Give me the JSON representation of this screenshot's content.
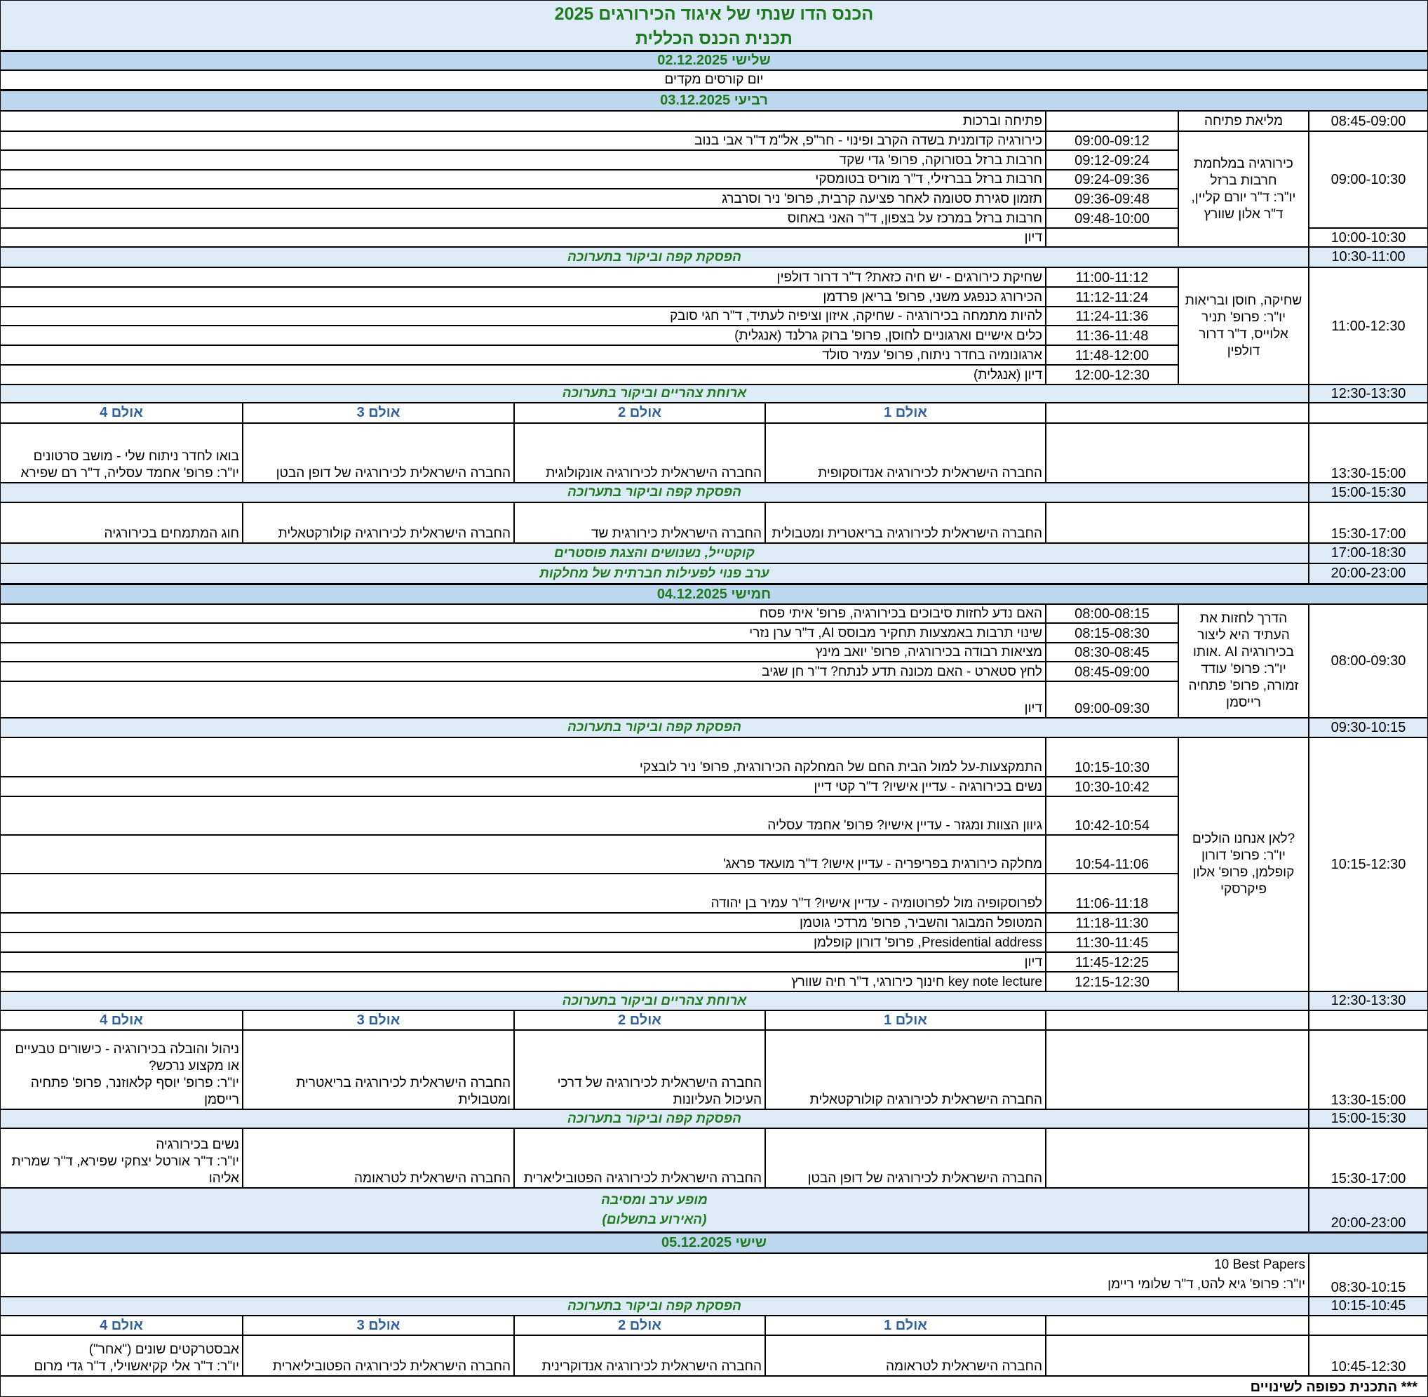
{
  "header": {
    "title": "הכנס הדו שנתי של איגוד הכירורגים 2025",
    "subtitle": "תכנית הכנס הכללית"
  },
  "day1": {
    "label": "שלישי 02.12.2025",
    "text": "יום קורסים מקדים"
  },
  "day2": {
    "label": "רביעי 03.12.2025",
    "opening": {
      "time": "08:45-09:00",
      "session": "מליאת פתיחה",
      "talk": "פתיחה וברכות"
    },
    "s1": {
      "time": "09:00-10:30",
      "session": "כירורגיה במלחמת חרבות ברזל\nיו\"ר: ד\"ר יורם קליין, ד\"ר אלון שוורץ",
      "talks": [
        {
          "time": "09:00-09:12",
          "title": "כירורגיה קדומנית בשדה הקרב  ופינוי - חר\"פ, אל\"מ ד\"ר אבי בנוב"
        },
        {
          "time": "09:12-09:24",
          "title": "חרבות ברזל בסורוקה, פרופ' גדי שקד"
        },
        {
          "time": "09:24-09:36",
          "title": "חרבות ברזל בברזילי, ד\"ר מוריס בטומסקי"
        },
        {
          "time": "09:36-09:48",
          "title": "תזמון סגירת סטומה לאחר פציעה קרבית, פרופ' ניר וסרברג"
        },
        {
          "time": "09:48-10:00",
          "title": "חרבות ברזל במרכז על בצפון, ד\"ר האני באחוס"
        }
      ]
    },
    "disc1": {
      "time": "10:00-10:30",
      "title": "דיון"
    },
    "coffee1": {
      "time": "10:30-11:00",
      "label": "הפסקת קפה וביקור בתערוכה"
    },
    "s2": {
      "time": "11:00-12:30",
      "session": "שחיקה, חוסן ובריאות\nיו\"ר: פרופ' תניר אלוייס, ד\"ר דרור דולפין",
      "talks": [
        {
          "time": "11:00-11:12",
          "title": "שחיקת כירורגים - יש חיה כזאת? ד\"ר דרור דולפין"
        },
        {
          "time": "11:12-11:24",
          "title": "הכירורג כנפגע משני, פרופ' בריאן פרדמן"
        },
        {
          "time": "11:24-11:36",
          "title": "להיות מתמחה בכירורגיה - שחיקה, איזון וציפיה לעתיד, ד\"ר חגי סובק"
        },
        {
          "time": "11:36-11:48",
          "title": "כלים אישיים וארגוניים לחוסן, פרופ' ברוק גרלנד (אנגלית)"
        },
        {
          "time": "11:48-12:00",
          "title": "ארגונומיה בחדר ניתוח, פרופ' עמיר סולד"
        },
        {
          "time": "12:00-12:30",
          "title": "דיון (אנגלית)"
        }
      ]
    },
    "lunch": {
      "time": "12:30-13:30",
      "label": "ארוחת צהריים וביקור בתערוכה"
    },
    "halls": [
      "אולם 1",
      "אולם 2",
      "אולם 3",
      "אולם 4"
    ],
    "p1": {
      "time": "13:30-15:00",
      "cells": [
        "החברה הישראלית לכירורגיה אנדוסקופית",
        "החברה הישראלית לכירורגיה אונקולוגית",
        "החברה הישראלית לכירורגיה של דופן הבטן",
        "בואו לחדר ניתוח שלי - מושב סרטונים\nיו\"ר: פרופ' אחמד עסליה, ד\"ר רם שפירא"
      ]
    },
    "coffee2": {
      "time": "15:00-15:30",
      "label": "הפסקת קפה וביקור בתערוכה"
    },
    "p2": {
      "time": "15:30-17:00",
      "cells": [
        "החברה הישראלית לכירורגיה בריאטרית ומטבולית",
        "החברה הישראלית כירורגית שד",
        "החברה הישראלית לכירורגיה קולורקטאלית",
        "חוג המתמחים בכירורגיה"
      ]
    },
    "cocktail": {
      "time": "17:00-18:30",
      "label": "קוקטייל, נשנושים והצגת פוסטרים"
    },
    "evening": {
      "time": "20:00-23:00",
      "label": "ערב פנוי לפעילות חברתית של מחלקות"
    }
  },
  "day3": {
    "label": "חמישי 04.12.2025",
    "s1": {
      "time": "08:00-09:30",
      "session": "הדרך לחזות את העתיד היא ליצור אותו. AI בכירורגיה\nיו\"ר: פרופ' עודד זמורה, פרופ' פתחיה רייסמן",
      "talks": [
        {
          "time": "08:00-08:15",
          "title": "האם נדע לחזות סיבוכים בכירורגיה, פרופ' איתי פסח"
        },
        {
          "time": "08:15-08:30",
          "title": "שינוי תרבות באמצעות תחקיר מבוסס AI, ד\"ר ערן נזרי"
        },
        {
          "time": "08:30-08:45",
          "title": "מציאות רבודה בכירורגיה, פרופ' יואב מינץ"
        },
        {
          "time": "08:45-09:00",
          "title": "לחץ סטארט - האם מכונה תדע לנתח? ד\"ר חן שגיב"
        },
        {
          "time": "09:00-09:30",
          "title": "דיון"
        }
      ]
    },
    "coffee1": {
      "time": "09:30-10:15",
      "label": "הפסקת קפה וביקור בתערוכה"
    },
    "s2": {
      "time": "10:15-12:30",
      "session": "לאן אנחנו הולכים?\nיו\"ר:  פרופ' דורון קופלמן, פרופ' אלון פיקרסקי",
      "talks": [
        {
          "time": "10:15-10:30",
          "title": "התמקצעות-על למול הבית החם של המחלקה הכירורגית, פרופ' ניר לובצקי"
        },
        {
          "time": "10:30-10:42",
          "title": "נשים בכירורגיה - עדיין אישיו? ד\"ר קטי דיין"
        },
        {
          "time": "10:42-10:54",
          "title": "גיוון הצוות ומגזר - עדיין אישיו? פרופ' אחמד עסליה"
        },
        {
          "time": "10:54-11:06",
          "title": "מחלקה כירורגית בפריפריה - עדיין אישו? ד\"ר מועאד פראג'"
        },
        {
          "time": "11:06-11:18",
          "title": "לפרוסקופיה מול לפרוטומיה - עדיין אישיו? ד\"ר עמיר בן יהודה"
        },
        {
          "time": "11:18-11:30",
          "title": "המטופל המבוגר והשביר,  פרופ' מרדכי גוטמן"
        },
        {
          "time": "11:30-11:45",
          "title": "Presidential address, פרופ' דורון קופלמן"
        },
        {
          "time": "11:45-12:25",
          "title": "דיון"
        },
        {
          "time": "12:15-12:30",
          "title": "key note lecture חינוך כירורגי, ד\"ר חיה שוורץ"
        }
      ]
    },
    "lunch": {
      "time": "12:30-13:30",
      "label": "ארוחת צהריים וביקור בתערוכה"
    },
    "halls": [
      "אולם 1",
      "אולם 2",
      "אולם 3",
      "אולם 4"
    ],
    "p1": {
      "time": "13:30-15:00",
      "cells": [
        "החברה הישראלית לכירורגיה קולורקטאלית",
        "החברה הישראלית לכירורגיה של דרכי העיכול העליונות",
        "החברה הישראלית לכירורגיה בריאטרית ומטבולית",
        "ניהול והובלה בכירורגיה - כישורים טבעיים או מקצוע נרכש?\nיו\"ר: פרופ' יוסף קלאוזנר, פרופ' פתחיה רייסמן"
      ]
    },
    "coffee2": {
      "time": "15:00-15:30",
      "label": "הפסקת קפה וביקור בתערוכה"
    },
    "p2": {
      "time": "15:30-17:00",
      "cells": [
        "החברה הישראלית לכירורגיה של דופן הבטן",
        "החברה הישראלית לכירורגיה הפטוביליארית",
        "החברה הישראלית לטראומה",
        "נשים בכירורגיה\nיו\"ר: ד\"ר אורטל יצחקי שפירא, ד\"ר שמרית אליהו"
      ]
    },
    "party": {
      "time": "20:00-23:00",
      "label": "מופע ערב ומסיבה",
      "note": "(האירוע בתשלום)"
    }
  },
  "day4": {
    "label": "שישי 05.12.2025",
    "best": {
      "time": "08:30-10:15",
      "title": "10 Best Papers",
      "chairs": "יו\"ר: פרופ' גיא להט, ד\"ר שלומי ריימן"
    },
    "coffee": {
      "time": "10:15-10:45",
      "label": "הפסקת קפה וביקור בתערוכה"
    },
    "halls": [
      "אולם 1",
      "אולם 2",
      "אולם 3",
      "אולם 4"
    ],
    "p1": {
      "time": "10:45-12:30",
      "cells": [
        "החברה הישראלית לטראומה",
        "החברה הישראלית לכירורגיה אנדוקרינית",
        "החברה הישראלית לכירורגיה הפטוביליארית",
        "אבסטרקטים שונים (\"אחר\")\nיו\"ר: ד\"ר אלי קקיאשוילי, ד\"ר גדי מרום"
      ]
    }
  },
  "footer": "*** התכנית כפופה לשינויים"
}
